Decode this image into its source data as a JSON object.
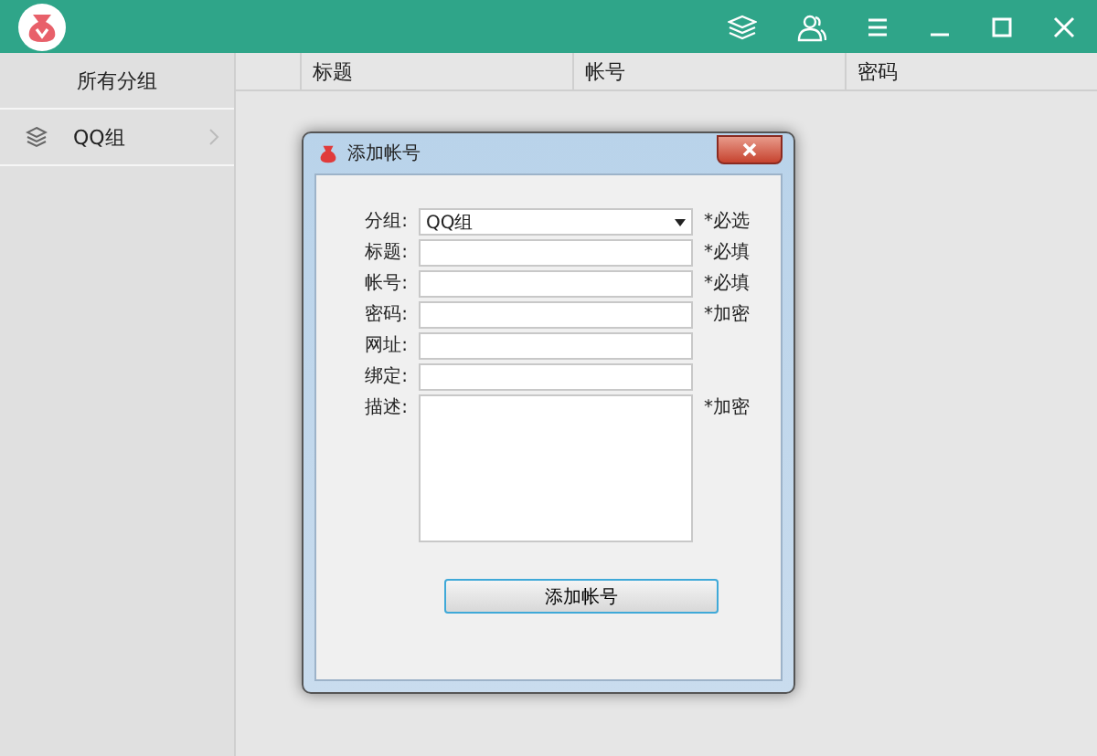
{
  "sidebar": {
    "header": "所有分组",
    "items": [
      {
        "label": "QQ组"
      }
    ]
  },
  "table": {
    "columns": [
      "标题",
      "帐号",
      "密码"
    ]
  },
  "dialog": {
    "title": "添加帐号",
    "fields": [
      {
        "kind": "select",
        "label": "分组:",
        "value": "QQ组",
        "note": "*必选"
      },
      {
        "kind": "input",
        "label": "标题:",
        "note": "*必填"
      },
      {
        "kind": "input",
        "label": "帐号:",
        "note": "*必填"
      },
      {
        "kind": "input",
        "label": "密码:",
        "note": "*加密"
      },
      {
        "kind": "input",
        "label": "网址:"
      },
      {
        "kind": "input",
        "label": "绑定:"
      },
      {
        "kind": "textarea",
        "label": "描述:",
        "note": "*加密"
      }
    ],
    "button": "添加帐号"
  }
}
